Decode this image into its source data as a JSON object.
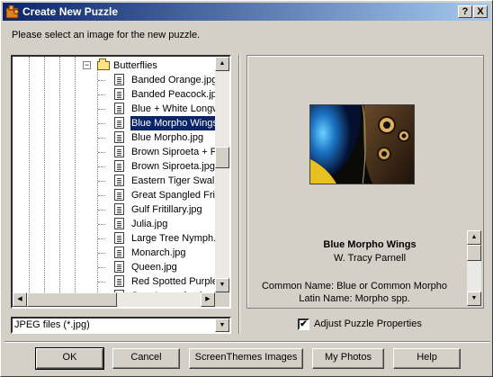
{
  "window": {
    "title": "Create New Puzzle",
    "help_button": "?",
    "close_button": "X"
  },
  "instruction": "Please select an image for the new puzzle.",
  "tree": {
    "folder": "Butterflies",
    "files": [
      "Banded Orange.jpg",
      "Banded Peacock.jp",
      "Blue + White Longw",
      "Blue Morpho Wings",
      "Blue Morpho.jpg",
      "Brown Siproeta + Fl",
      "Brown Siproeta.jpg",
      "Eastern Tiger Swall",
      "Great Spangled Frit",
      "Gulf Fritillary.jpg",
      "Julia.jpg",
      "Large Tree Nymph.",
      "Monarch.jpg",
      "Queen.jpg",
      "Red Spotted Purple",
      "Sara Longwing.jpg"
    ],
    "selected_index": 3
  },
  "file_type": {
    "selected": "JPEG files (*.jpg)"
  },
  "preview": {
    "title": "Blue Morpho Wings",
    "author": "W. Tracy Parnell",
    "common_name": "Common Name: Blue or Common Morpho",
    "latin_name": "Latin Name: Morpho spp."
  },
  "adjust": {
    "label": "Adjust Puzzle Properties",
    "checked": true,
    "check_mark": "✔"
  },
  "buttons": {
    "ok": "OK",
    "cancel": "Cancel",
    "screenthemes": "ScreenThemes Images",
    "my_photos": "My Photos",
    "help": "Help"
  },
  "colors": {
    "title_start": "#0a246a",
    "title_end": "#a6caf0",
    "selection": "#0a246a",
    "face": "#d4d0c8"
  }
}
